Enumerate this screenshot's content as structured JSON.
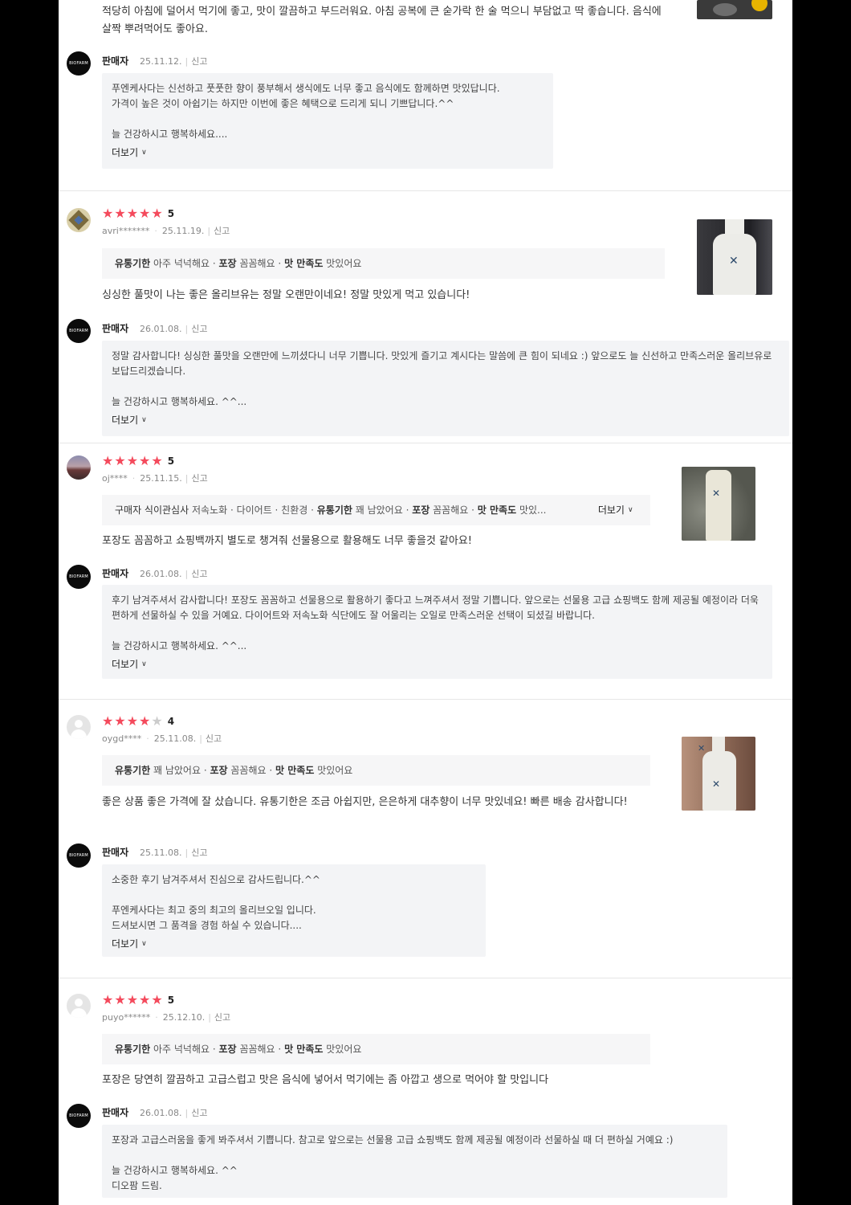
{
  "report_label": "신고",
  "more_label": "더보기",
  "seller_label": "판매자",
  "seller_logo_text": "BIOFARM",
  "review0": {
    "text": "적당히 아침에 덜어서 먹기에 좋고, 맛이 깔끔하고 부드러워요. 아침 공복에 큰 숟가락 한 술 먹으니 부담없고 딱 좋습니다. 음식에 살짝 뿌려먹어도 좋아요.",
    "reply": {
      "date": "25.11.12.",
      "line1": "푸엔케사다는 신선하고 풋풋한 향이 풍부해서 생식에도 너무 좋고 음식에도 함께하면 맛있답니다.",
      "line2": "가격이 높은 것이 아쉽기는 하지만 이번에 좋은 혜택으로 드리게 되니 기쁘답니다.^^",
      "line3": "늘 건강하시고 행복하세요...."
    }
  },
  "review1": {
    "rating": 5,
    "rating_label": "5",
    "user": "avri*******",
    "date": "25.11.19.",
    "opt_a_label": "유통기한",
    "opt_a_value": "아주 넉넉해요",
    "opt_b_label": "포장",
    "opt_b_value": "꼼꼼해요",
    "opt_c_label": "맛 만족도",
    "opt_c_value": "맛있어요",
    "text": "싱싱한 풀맛이 나는 좋은 올리브유는 정말 오랜만이네요! 정말 맛있게 먹고 있습니다!",
    "reply": {
      "date": "26.01.08.",
      "line1": "정말 감사합니다! 싱싱한 풀맛을 오랜만에 느끼셨다니 너무 기쁩니다. 맛있게 즐기고 계시다는 말씀에 큰 힘이 되네요 :) 앞으로도 늘 신선하고 만족스러운 올리브유로 보답드리겠습니다.",
      "line3": "늘 건강하시고 행복하세요. ^^..."
    }
  },
  "review2": {
    "rating": 5,
    "rating_label": "5",
    "user": "oj****",
    "date": "25.11.15.",
    "opt_prefix": "구매자 식이관심사",
    "opt_prefix_value": "저속노화 · 다이어트 · 친환경",
    "opt_a_label": "유통기한",
    "opt_a_value": "꽤 남았어요",
    "opt_b_label": "포장",
    "opt_b_value": "꼼꼼해요",
    "opt_c_label": "맛 만족도",
    "opt_c_value": "맛있...",
    "text": "포장도 꼼꼼하고 쇼핑백까지 별도로 챙겨줘 선물용으로 활용해도 너무 좋을것 같아요!",
    "reply": {
      "date": "26.01.08.",
      "line1": "후기 남겨주셔서 감사합니다! 포장도 꼼꼼하고 선물용으로 활용하기 좋다고 느껴주셔서 정말 기쁩니다. 앞으로는 선물용 고급 쇼핑백도 함께 제공될 예정이라 더욱 편하게 선물하실 수 있을 거예요. 다이어트와 저속노화 식단에도 잘 어울리는 오일로 만족스러운 선택이 되셨길 바랍니다.",
      "line3": "늘 건강하시고 행복하세요. ^^..."
    }
  },
  "review3": {
    "rating": 4,
    "rating_label": "4",
    "user": "oygd****",
    "date": "25.11.08.",
    "opt_a_label": "유통기한",
    "opt_a_value": "꽤 남았어요",
    "opt_b_label": "포장",
    "opt_b_value": "꼼꼼해요",
    "opt_c_label": "맛 만족도",
    "opt_c_value": "맛있어요",
    "text": "좋은 상품 좋은 가격에 잘 샀습니다. 유통기한은 조금 아쉽지만, 은은하게 대추향이 너무 맛있네요! 빠른 배송 감사합니다!",
    "reply": {
      "date": "25.11.08.",
      "line1": "소중한 후기 남겨주셔서 진심으로 감사드립니다.^^",
      "line2": "푸엔케사다는 최고 중의 최고의 올리브오일 입니다.",
      "line3": "드셔보시면 그 품격을 경험 하실 수 있습니다...."
    }
  },
  "review4": {
    "rating": 5,
    "rating_label": "5",
    "user": "puyo******",
    "date": "25.12.10.",
    "opt_a_label": "유통기한",
    "opt_a_value": "아주 넉넉해요",
    "opt_b_label": "포장",
    "opt_b_value": "꼼꼼해요",
    "opt_c_label": "맛 만족도",
    "opt_c_value": "맛있어요",
    "text": "포장은 당연히 깔끔하고 고급스럽고 맛은 음식에 넣어서 먹기에는 좀 아깝고 생으로 먹어야 할 맛입니다",
    "reply": {
      "date": "26.01.08.",
      "line1": "포장과 고급스러움을 좋게 봐주셔서 기쁩니다. 참고로 앞으로는 선물용 고급 쇼핑백도 함께 제공될 예정이라 선물하실 때 더 편하실 거예요 :)",
      "line2": "늘 건강하시고 행복하세요. ^^",
      "line3": "디오팜 드림."
    }
  },
  "colors": {
    "star": "#f44a5c",
    "star_off": "#cccccc",
    "reply_bg": "#f3f4f6"
  },
  "icons": [
    "star-icon",
    "chevron-down-icon",
    "default-avatar-icon"
  ]
}
